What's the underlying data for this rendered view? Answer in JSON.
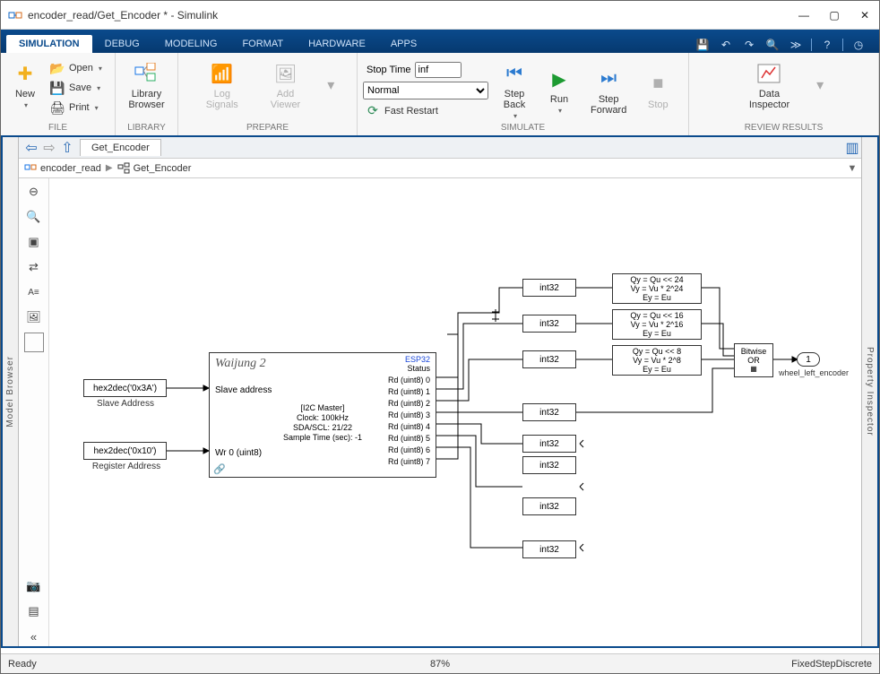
{
  "window": {
    "title": "encoder_read/Get_Encoder * - Simulink"
  },
  "tabs": {
    "simulation": "SIMULATION",
    "debug": "DEBUG",
    "modeling": "MODELING",
    "format": "FORMAT",
    "hardware": "HARDWARE",
    "apps": "APPS"
  },
  "toolstrip": {
    "file": {
      "new": "New",
      "open": "Open",
      "save": "Save",
      "print": "Print",
      "group": "FILE"
    },
    "library": {
      "label": "Library\nBrowser",
      "group": "LIBRARY"
    },
    "prepare": {
      "log": "Log\nSignals",
      "add": "Add\nViewer",
      "group": "PREPARE"
    },
    "sim": {
      "stoptime": "Stop Time",
      "stopval": "inf",
      "mode": "Normal",
      "fast": "Fast Restart",
      "stepback": "Step\nBack",
      "run": "Run",
      "stepfwd": "Step\nForward",
      "stop": "Stop",
      "group": "SIMULATE"
    },
    "review": {
      "data": "Data\nInspector",
      "group": "REVIEW RESULTS"
    }
  },
  "panels": {
    "left": "Model Browser",
    "right": "Property Inspector"
  },
  "editor": {
    "tab": "Get_Encoder"
  },
  "crumbs": {
    "root": "encoder_read",
    "sub": "Get_Encoder"
  },
  "blocks": {
    "slave_const": "hex2dec('0x3A')",
    "slave_label": "Slave Address",
    "reg_const": "hex2dec('0x10')",
    "reg_label": "Register Address",
    "i2c_title": "Waijung 2",
    "i2c_chip": "ESP32",
    "i2c_status": "Status",
    "i2c_slave": "Slave address",
    "i2c_wr": "Wr 0 (uint8)",
    "i2c_body1": "[I2C Master]",
    "i2c_body2": "Clock: 100kHz",
    "i2c_body3": "SDA/SCL: 21/22",
    "i2c_body4": "Sample Time (sec): -1",
    "rd0": "Rd (uint8) 0",
    "rd1": "Rd (uint8) 1",
    "rd2": "Rd (uint8) 2",
    "rd3": "Rd (uint8) 3",
    "rd4": "Rd (uint8) 4",
    "rd5": "Rd (uint8) 5",
    "rd6": "Rd (uint8) 6",
    "rd7": "Rd (uint8) 7",
    "cast": "int32",
    "shift24a": "Qy = Qu << 24",
    "shift24b": "Vy = Vu * 2^24",
    "shift24c": "Ey = Eu",
    "shift16a": "Qy = Qu << 16",
    "shift16b": "Vy = Vu * 2^16",
    "shift16c": "Ey = Eu",
    "shift8a": "Qy = Qu << 8",
    "shift8b": "Vy = Vu * 2^8",
    "shift8c": "Ey = Eu",
    "bitor1": "Bitwise",
    "bitor2": "OR",
    "out_num": "1",
    "out_label": "wheel_left_encoder"
  },
  "status": {
    "ready": "Ready",
    "zoom": "87%",
    "solver": "FixedStepDiscrete"
  }
}
